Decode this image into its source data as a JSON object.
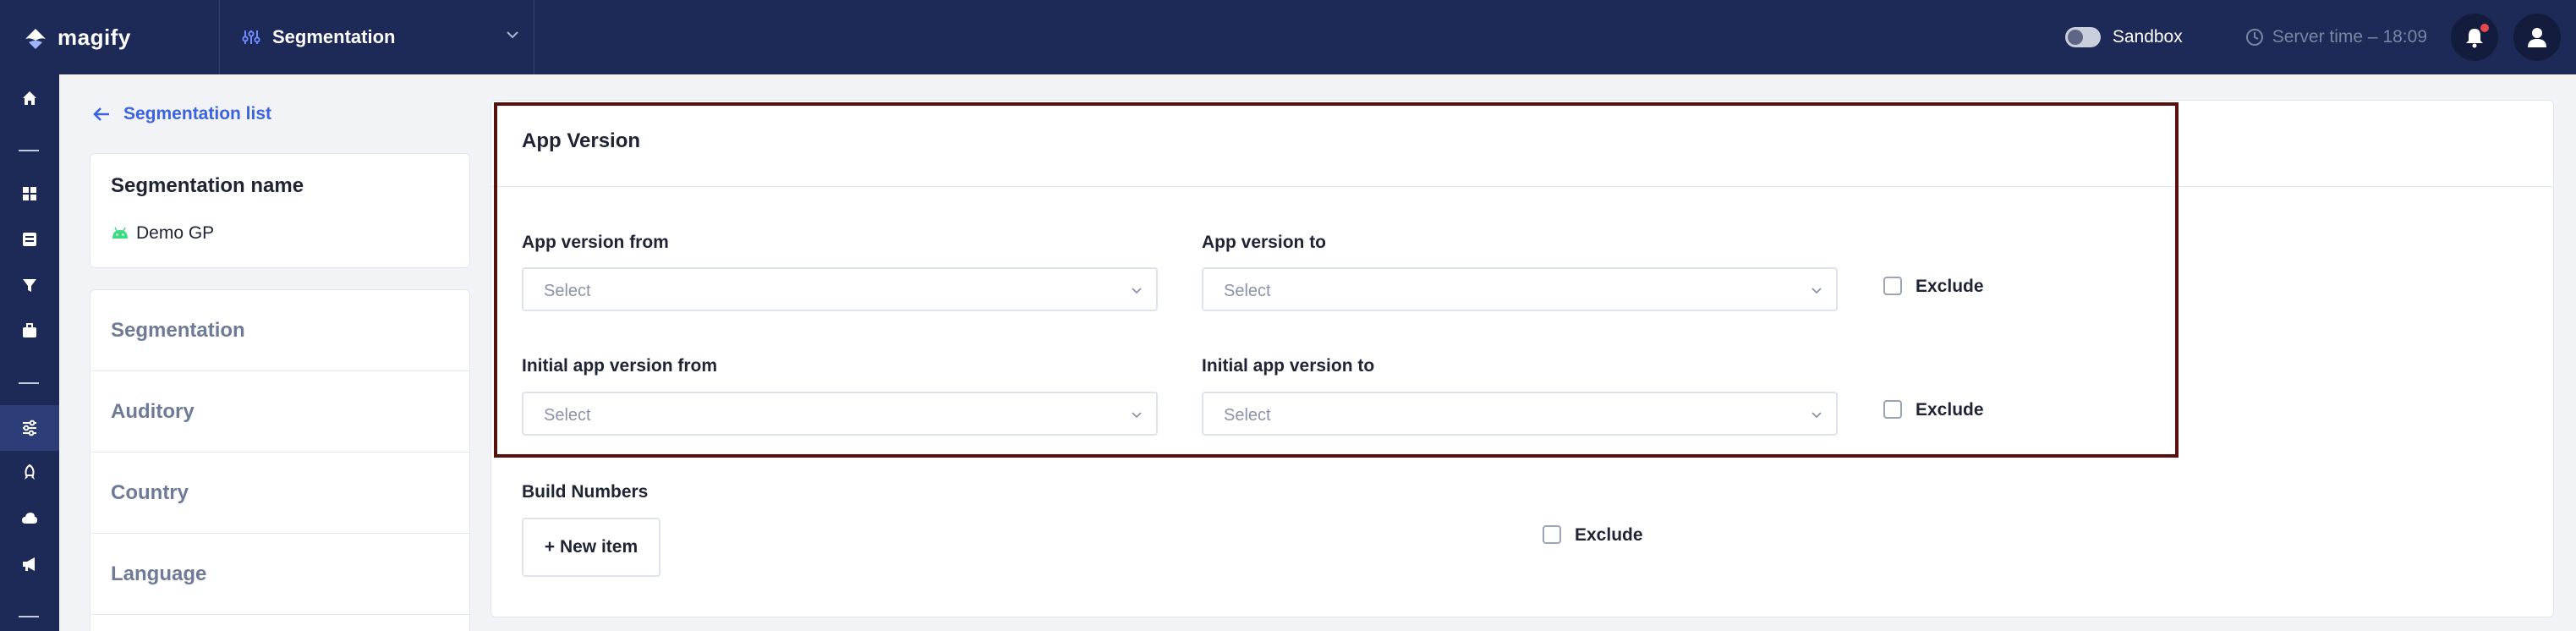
{
  "header": {
    "logo_text": "magify",
    "segment_selector_label": "Segmentation",
    "sandbox_label": "Sandbox",
    "server_time": "Server time – 18:09"
  },
  "sidebar": {
    "back_link": "Segmentation list",
    "name_card": {
      "title": "Segmentation name",
      "app_name": "Demo GP"
    },
    "menu": [
      "Segmentation",
      "Auditory",
      "Country",
      "Language"
    ]
  },
  "main": {
    "section_title": "App Version",
    "app_version_from_label": "App version from",
    "app_version_to_label": "App version to",
    "initial_app_version_from_label": "Initial app version from",
    "initial_app_version_to_label": "Initial app version to",
    "select_placeholder": "Select",
    "exclude_label": "Exclude",
    "build_numbers_label": "Build Numbers",
    "new_item_button": "+ New item"
  },
  "colors": {
    "topbar": "#1d2a57",
    "accent_link": "#3b63e0",
    "highlight_border": "#5a0f0f",
    "notification_dot": "#e5484d"
  },
  "icons": [
    "logo-icon",
    "sliders-icon",
    "chevron-down-icon",
    "clock-icon",
    "bell-icon",
    "user-icon",
    "home-icon",
    "grid-icon",
    "list-icon",
    "filter-icon",
    "briefcase-icon",
    "rocket-icon",
    "cloud-icon",
    "megaphone-icon",
    "arrow-left-icon",
    "android-icon"
  ]
}
